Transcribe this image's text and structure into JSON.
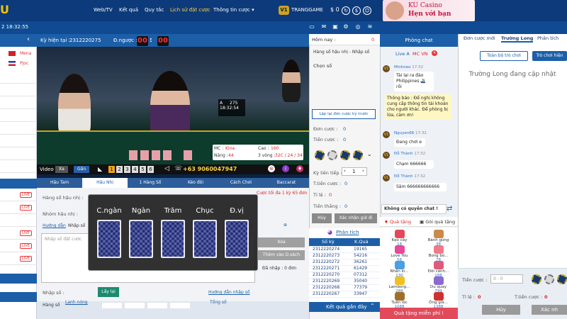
{
  "nav": {
    "logo": "U",
    "links": [
      "Web/TV",
      "Kết quả",
      "Quy tắc",
      "Lịch sử đặt cược",
      "Thông tin cược ▾"
    ],
    "vip": "V1",
    "username": "TRANGGAME",
    "balance": "$ 0",
    "promo_line1": "KU Casino",
    "promo_line2": "Hẹn với bạn"
  },
  "subbar": {
    "clock": "2 18:32:55"
  },
  "left": {
    "flags": [
      {
        "label": "Mena",
        "color": "#d21f2b"
      },
      {
        "label": "Pjoc",
        "color": "#1f3fa0"
      }
    ],
    "live": "LIVE"
  },
  "info": {
    "period_label": "Kỳ hiện tại :",
    "period": "2312220275",
    "countdown_label": "Đ.ngược :",
    "countdown_min": "00",
    "countdown_sec": "00"
  },
  "video": {
    "table_label": "A",
    "table_value": "275",
    "table_time": "18:32:54",
    "mc_label": "MC :",
    "mc_name": "Kina",
    "level_label": "Năng :",
    "level_value": "44",
    "height_label": "Cao :",
    "height_value": "160",
    "rounds_label": "3 vòng :",
    "rounds_value": "32C / 24 / 34",
    "card_labels": [
      "C.ngàn",
      "Ngàn",
      "Trăm",
      "Chục",
      "Đ.vị"
    ]
  },
  "videobar": {
    "label": "Video",
    "btn_far": "Xa",
    "btn_near": "Gần",
    "numbers": [
      "1",
      "2",
      "3",
      "4",
      "5",
      "6"
    ],
    "phone": "+63 9060047947"
  },
  "game_tabs": [
    "Hậu Tam",
    "Hậu Nhị",
    "1 Hàng Số",
    "Kèo đôi",
    "Cách Chơi",
    "Baccarat"
  ],
  "form": {
    "row1_label": "Hàng số hậu nhị :",
    "row1_hint": "Cược tối đa 1 kỳ 65 đơn",
    "row2_label": "Nhóm hậu nhị :",
    "guide_link": "Hướng dẫn",
    "guide_text": "Nhập số",
    "input_placeholder": "Nhập số đặt cược",
    "clear_btn": "Xóa",
    "add_btn": "Thêm vào D.sách",
    "select_label": "Đã nhập : 0 đơn",
    "enter_label": "Nhập số :",
    "import_btn": "Lấy lại",
    "import_link": "Hướng dẫn nhập số",
    "bottom_tabs": [
      "Hàng số",
      "Lạnh nóng",
      "Kèo",
      "Đôi",
      "Tam",
      "Lô",
      "Tổng số"
    ],
    "bottom_icons": [
      "Số",
      "Đơn"
    ]
  },
  "mid": {
    "header": "Hôm nay :",
    "header_value": "0",
    "selected_type": "Hàng số hậu nhị - Nhập số",
    "choose_label": "Chọn số",
    "reset_btn": "Lập lại đơn cược kỳ trước",
    "orders_label": "Đơn cược :",
    "orders_value": "0",
    "stake_label": "Tiền cược :",
    "stake_value": "0",
    "periods_label": "Kỳ liên tiếp :",
    "periods_value": "1",
    "total_label": "T.tiền cược :",
    "total_value": "0",
    "ratio_label": "Tỉ lệ :",
    "ratio_value": "0",
    "win_label": "Tiền thắng :",
    "win_value": "0",
    "cancel_btn": "Hủy",
    "confirm_btn": "Xác nhận gửi đi",
    "analysis": "Phân tích",
    "res_head_period": "Số kỳ",
    "res_head_result": "K.Quả",
    "results": [
      {
        "period": "2312220274",
        "result": "19165"
      },
      {
        "period": "2312220273",
        "result": "54216"
      },
      {
        "period": "2312220272",
        "result": "36261"
      },
      {
        "period": "2312220271",
        "result": "61429"
      },
      {
        "period": "2312220270",
        "result": "07312"
      },
      {
        "period": "2312220269",
        "result": "35040"
      },
      {
        "period": "2312220268",
        "result": "77379"
      },
      {
        "period": "2312220267",
        "result": "33947"
      }
    ],
    "recent": "Kết quả gần đây"
  },
  "chat": {
    "title": "Phòng chat",
    "room": "Live A",
    "room_mc": "MC VN",
    "messages": [
      {
        "user": "Minhneo",
        "time": "17:32",
        "text": "Tài lại ra đảo Philippines 🚢 rồi"
      },
      {
        "user": "Nguyen66",
        "time": "17:32",
        "text": "Đang chơi e"
      },
      {
        "user": "Đỗ Thành",
        "time": "17:32",
        "text": "Chạm 666666"
      },
      {
        "user": "Đỗ Thành",
        "time": "17:32",
        "text": "Săm 666666666666"
      }
    ],
    "notice": "Thông báo : Để nghị không cung cấp thông tin tài khoản cho người khác. Để phòng bị lừa, cảm ơn!",
    "disabled": "Không có quyền chat !",
    "gift_tab1": "Quà tặng",
    "gift_tab2": "Gói quà tặng",
    "gifts": [
      {
        "name": "Kẹo cây",
        "price": "18"
      },
      {
        "name": "Bánh gừng",
        "price": "38"
      },
      {
        "name": "Love You",
        "price": "58"
      },
      {
        "name": "Bong bó...",
        "price": "78"
      },
      {
        "name": "Nhẫn ki...",
        "price": "130"
      },
      {
        "name": "Đôi cánh...",
        "price": "188"
      },
      {
        "name": "Lamborg...",
        "price": "288"
      },
      {
        "name": "Du quay",
        "price": "799"
      },
      {
        "name": "Tuần lộc",
        "price": "1088"
      },
      {
        "name": "Ông già...",
        "price": "1388"
      }
    ],
    "free_gift": "Quà tặng miễn phí !"
  },
  "right": {
    "tabs": [
      "Đơn cược mới",
      "Trường Long",
      "Phân tích"
    ],
    "btn_all": "Toàn bộ trò chơi",
    "btn_current": "Trò chơi hiện",
    "updating": "Trường Long đang cập nhật",
    "stake_label": "Tiền cược :",
    "stake_placeholder": "0 - 0",
    "ratio_label": "Tỉ lệ :",
    "ratio_value": "0",
    "total_label": "T.tiền cược :",
    "total_value": "0",
    "cancel": "Hủy",
    "confirm": "Xác nh"
  }
}
